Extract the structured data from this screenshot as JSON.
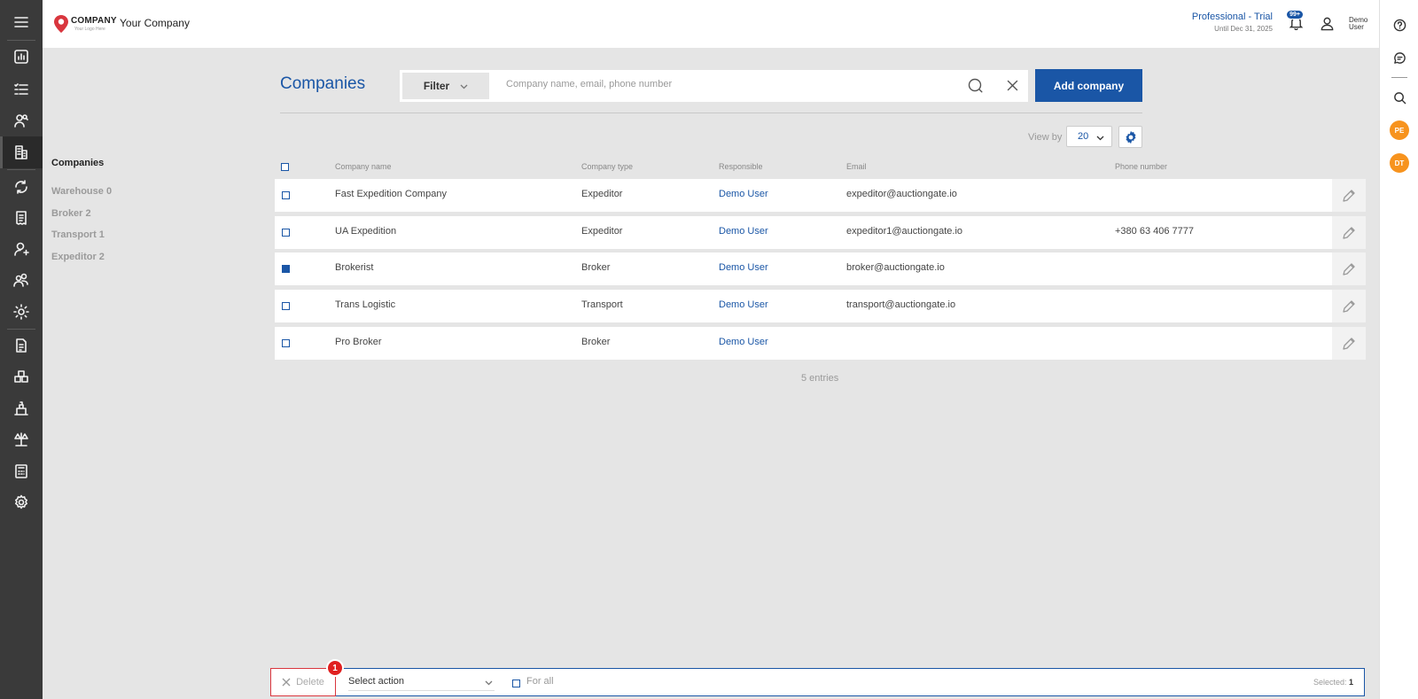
{
  "header": {
    "logo_text": "COMPANY",
    "logo_tagline": "Your Logo Here",
    "company_name": "Your Company",
    "plan_name": "Professional - Trial",
    "plan_until": "Until Dec 31, 2025",
    "notification_count": "99+",
    "user_name": "Demo User"
  },
  "sidebar": {
    "items": [
      "menu-icon",
      "dashboard-icon",
      "checklist-icon",
      "users-search-icon",
      "building-icon",
      "exchange-icon",
      "receipt-icon",
      "person-icon",
      "group-icon",
      "gear-users-icon",
      "document-icon",
      "boxes-icon",
      "warehouse-icon",
      "scale-icon",
      "calculator-icon",
      "settings-icon"
    ]
  },
  "rightbar": {
    "avatars": [
      "PE",
      "DT"
    ]
  },
  "subnav": {
    "title": "Companies",
    "items": [
      {
        "label": "Warehouse 0"
      },
      {
        "label": "Broker 2"
      },
      {
        "label": "Transport 1"
      },
      {
        "label": "Expeditor 2"
      }
    ]
  },
  "main": {
    "title": "Companies",
    "filter_label": "Filter",
    "search_placeholder": "Company name, email, phone number",
    "add_button": "Add company",
    "view_by_label": "View by",
    "view_by_value": "20",
    "columns": {
      "name": "Company name",
      "type": "Company type",
      "responsible": "Responsible",
      "email": "Email",
      "phone": "Phone number"
    },
    "rows": [
      {
        "name": "Fast Expedition Company",
        "type": "Expeditor",
        "responsible": "Demo User",
        "email": "expeditor@auctiongate.io",
        "phone": "",
        "checked": false
      },
      {
        "name": "UA Expedition",
        "type": "Expeditor",
        "responsible": "Demo User",
        "email": "expeditor1@auctiongate.io",
        "phone": "+380 63 406 7777",
        "checked": false
      },
      {
        "name": "Brokerist",
        "type": "Broker",
        "responsible": "Demo User",
        "email": "broker@auctiongate.io",
        "phone": "",
        "checked": true
      },
      {
        "name": "Trans Logistic",
        "type": "Transport",
        "responsible": "Demo User",
        "email": "transport@auctiongate.io",
        "phone": "",
        "checked": false
      },
      {
        "name": "Pro Broker",
        "type": "Broker",
        "responsible": "Demo User",
        "email": "",
        "phone": "",
        "checked": false
      }
    ],
    "entries": "5 entries"
  },
  "actionbar": {
    "delete_label": "Delete",
    "notification": "1",
    "select_action": "Select action",
    "for_all": "For all",
    "selected_label": "Selected:",
    "selected_count": "1"
  },
  "colors": {
    "accent": "#1a56a6",
    "sidebar": "#3a3a3a",
    "avatar": "#f7931e",
    "danger": "#e02020"
  }
}
